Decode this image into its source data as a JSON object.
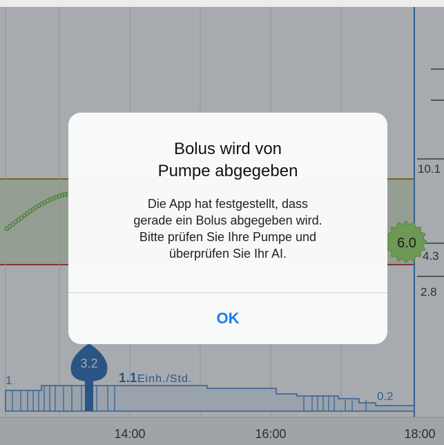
{
  "chart_data": {
    "type": "line",
    "x_ticks": [
      "14:00",
      "16:00",
      "18:00"
    ],
    "y_labels": [
      "10.1",
      "4.3",
      "2.8"
    ],
    "target_range": {
      "low": 4.3,
      "high": 10.1
    },
    "glucose": {
      "current_value": "6.0"
    },
    "bolus": {
      "label": "3.2"
    },
    "basal": {
      "current_rate": "1.1",
      "unit": "Einh./Std.",
      "start_label": "1",
      "end_label": "0.2"
    },
    "grid": true
  },
  "alert": {
    "title_line1": "Bolus wird von",
    "title_line2": "Pumpe abgegeben",
    "message_line1": "Die App hat festgestellt, dass",
    "message_line2": "gerade ein Bolus abgegeben wird.",
    "message_line3": "Bitte prüfen Sie Ihre Pumpe und",
    "message_line4": "überprüfen Sie Ihr AI.",
    "ok_label": "OK"
  },
  "colors": {
    "accent": "#1a7fe8",
    "target_band": "#dfe9cf",
    "range_line": "#b8860b",
    "glucose_dot": "#7ccf5a",
    "bolus": "#2f6fb6",
    "basal": "#3d7fcc"
  }
}
